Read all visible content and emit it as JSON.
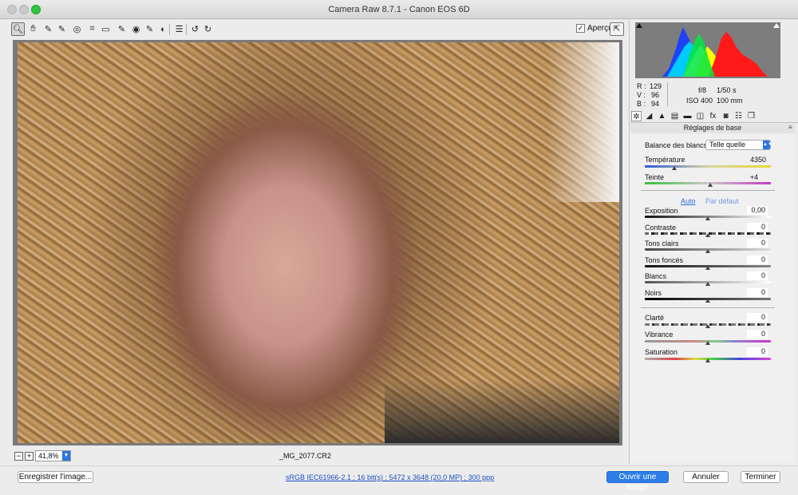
{
  "window": {
    "title": "Camera Raw 8.7.1  -  Canon EOS 6D"
  },
  "toolbar": {
    "tools": [
      {
        "name": "zoom-tool",
        "glyph": "🔍︎",
        "active": true
      },
      {
        "name": "hand-tool",
        "glyph": "✋︎"
      },
      {
        "name": "white-balance-tool",
        "glyph": "✎"
      },
      {
        "name": "color-sampler-tool",
        "glyph": "✎"
      },
      {
        "name": "targeted-adjustment-tool",
        "glyph": "◎"
      },
      {
        "name": "crop-tool",
        "glyph": "⌗"
      },
      {
        "name": "straighten-tool",
        "glyph": "▭"
      },
      {
        "name": "spot-removal-tool",
        "glyph": "✎"
      },
      {
        "name": "red-eye-tool",
        "glyph": "◉"
      },
      {
        "name": "adjustment-brush-tool",
        "glyph": "✎"
      },
      {
        "name": "graduated-filter-tool",
        "glyph": "◐"
      },
      {
        "name": "radial-filter-tool",
        "glyph": "▣"
      },
      {
        "name": "preferences-tool",
        "glyph": "☰"
      },
      {
        "name": "rotate-ccw-tool",
        "glyph": "↺"
      },
      {
        "name": "rotate-cw-tool",
        "glyph": "↻"
      }
    ],
    "preview_label": "Aperçu",
    "preview_checked": "✓",
    "fullscreen_glyph": "⇱"
  },
  "status": {
    "zoom_minus": "−",
    "zoom_plus": "+",
    "zoom_value": "41,8%",
    "filename": "_MG_2077.CR2"
  },
  "bottom": {
    "save_label": "Enregistrer l'image...",
    "workflow_link": "sRGB IEC61966-2.1 ; 16 bit(s) ; 5472 x 3648 (20,0 MP) ; 300 ppp",
    "open_label": "Ouvrir une image",
    "cancel_label": "Annuler",
    "done_label": "Terminer"
  },
  "readout": {
    "r_label": "R :",
    "r": "129",
    "v_label": "V :",
    "v": "96",
    "b_label": "B :",
    "b": "94",
    "aperture": "f/8",
    "shutter": "1/50 s",
    "iso": "ISO 400",
    "focal": "100 mm"
  },
  "panel": {
    "tab_glyphs": [
      "✲",
      "◢",
      "▲",
      "▤",
      "▬",
      "◫",
      "fx",
      "◙",
      "☷",
      "❐"
    ],
    "section_title": "Réglages de base",
    "section_menu": "≡",
    "wb_label": "Balance des blancs :",
    "wb_value": "Telle quelle",
    "temperature_label": "Température",
    "temperature_value": "4350",
    "tint_label": "Teinte",
    "tint_value": "+4",
    "auto_link": "Auto",
    "default_link": "Par défaut",
    "exposure_label": "Exposition",
    "exposure_value": "0,00",
    "contrast_label": "Contraste",
    "contrast_value": "0",
    "highlights_label": "Tons clairs",
    "highlights_value": "0",
    "shadows_label": "Tons foncés",
    "shadows_value": "0",
    "whites_label": "Blancs",
    "whites_value": "0",
    "blacks_label": "Noirs",
    "blacks_value": "0",
    "clarity_label": "Clarté",
    "clarity_value": "0",
    "vibrance_label": "Vibrance",
    "vibrance_value": "0",
    "saturation_label": "Saturation",
    "saturation_value": "0"
  }
}
